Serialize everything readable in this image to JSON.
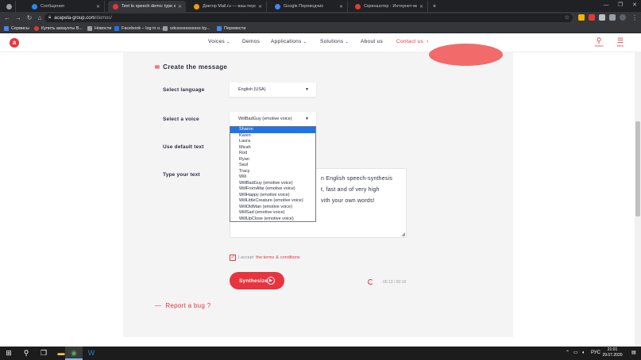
{
  "browser": {
    "tabs": [
      {
        "label": "",
        "color": "#9aa0a6"
      },
      {
        "label": "Сообщения",
        "color": "#2787f5"
      },
      {
        "label": "Text to speech demo: type and l...",
        "color": "#e8343f"
      },
      {
        "label": "Диктор Mail.ru — ваш персона...",
        "color": "#f59c00"
      },
      {
        "label": "Google Переводчик",
        "color": "#4285f4"
      },
      {
        "label": "Скриншотер - Интернет-магази...",
        "color": "#e53935"
      }
    ],
    "new_tab_glyph": "+",
    "address": {
      "host": "acapela-group.com",
      "path": "/demos/"
    },
    "bookmarks": [
      {
        "label": "Сервисы",
        "color": "#4285f4"
      },
      {
        "label": "Купить аккаунты В...",
        "color": "#e53935"
      },
      {
        "label": "Новости",
        "color": "#9aa0a6"
      },
      {
        "label": "Facebook – log in o...",
        "color": "#1877f2"
      },
      {
        "label": "sdcsssssssssss by...",
        "color": "#9aa0a6"
      },
      {
        "label": "Перевести",
        "color": "#4285f4"
      }
    ]
  },
  "site": {
    "logo_letter": "a",
    "menu": [
      {
        "label": "Voices",
        "chevron": true
      },
      {
        "label": "Demos",
        "chevron": false
      },
      {
        "label": "Applications",
        "chevron": true
      },
      {
        "label": "Solutions",
        "chevron": true
      },
      {
        "label": "About us",
        "chevron": false
      }
    ],
    "contact": {
      "label": "Contact us",
      "chevron": "›"
    },
    "search_label": "Search",
    "menu_label": "Menu",
    "accent_color": "#e8343f"
  },
  "form": {
    "section_title": "Create the message",
    "language_label": "Select language",
    "language_value": "English (USA)",
    "voice_label": "Select a voice",
    "voice_value": "WillBadGuy (emotive voice)",
    "default_text_label": "Use default text",
    "type_text_label": "Type your text",
    "text_lines": [
      "n English speech-synthesis",
      "t, fast and of very high",
      "vith your own words!"
    ],
    "voice_options": [
      "Sharon",
      "Karen",
      "Laura",
      "Micah",
      "Rod",
      "Ryan",
      "Saul",
      "Tracy",
      "Will",
      "WillBadGuy (emotive voice)",
      "WillFromAfar (emotive voice)",
      "WillHappy (emotive voice)",
      "WillLittleCreature (emotive voice)",
      "WillOldMan (emotive voice)",
      "WillSad (emotive voice)",
      "WillUpClose (emotive voice)"
    ],
    "selected_option_index": 0,
    "terms_prefix": "I accept",
    "terms_link": "the terms",
    "terms_amp": "&",
    "conditions_link": "conditions",
    "terms_checked": true,
    "synthesize_label": "Synthesize",
    "player_time": "00:13 / 00:19",
    "report_bug": "Report a bug ?"
  },
  "taskbar": {
    "language": "РУС",
    "time": "21:01",
    "date": "29.07.2020"
  }
}
